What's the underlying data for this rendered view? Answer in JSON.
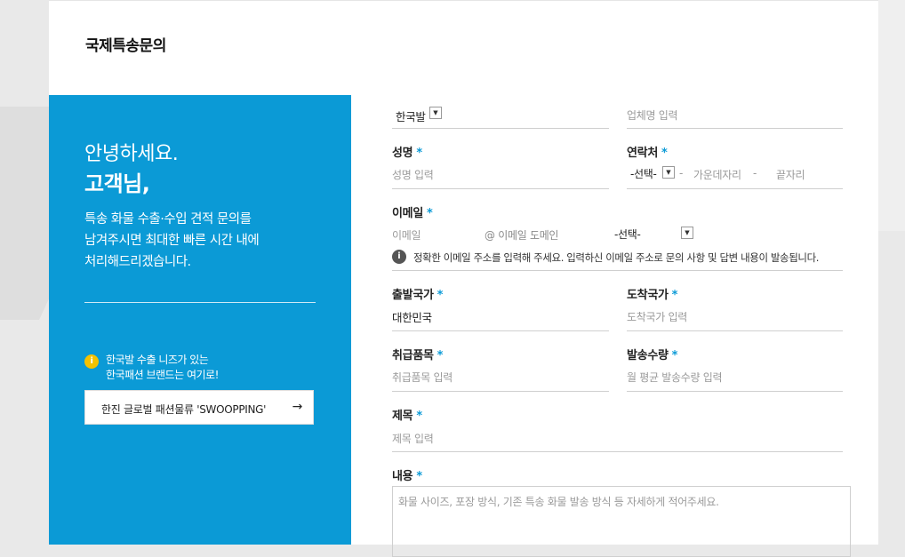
{
  "page": {
    "title": "국제특송문의"
  },
  "intro": {
    "greeting_line1": "안녕하세요.",
    "greeting_line2": "고객님,",
    "text_lines": [
      "특송 화물 수출·수입 견적 문의를",
      "남겨주시면 최대한 빠른 시간 내에",
      "처리해드리겠습니다."
    ],
    "notice_lines": [
      "한국발 수출 니즈가 있는",
      "한국패션 브랜드는 여기로!"
    ],
    "swoopping_button": "한진 글로벌 패션물류 'SWOOPPING'",
    "arrow": "→"
  },
  "form": {
    "origin_select": "한국발",
    "company_placeholder": "업체명 입력",
    "name": {
      "label": "성명",
      "placeholder": "성명 입력"
    },
    "contact": {
      "label": "연락처",
      "prefix_select": "-선택-",
      "separator1": "-",
      "middle_placeholder": "가운데자리",
      "separator2": "-",
      "last_placeholder": "끝자리"
    },
    "email": {
      "label": "이메일",
      "id_placeholder": "이메일",
      "domain_placeholder": "@ 이메일 도메인",
      "domain_select": "-선택-",
      "info_text": "정확한 이메일 주소를 입력해 주세요. 입력하신 이메일 주소로 문의 사항 및 답변 내용이 발송됩니다."
    },
    "departure": {
      "label": "출발국가",
      "value": "대한민국"
    },
    "arrival": {
      "label": "도착국가",
      "placeholder": "도착국가 입력"
    },
    "item": {
      "label": "취급품목",
      "placeholder": "취급품목 입력"
    },
    "volume": {
      "label": "발송수량",
      "placeholder": "월 평균 발송수량 입력"
    },
    "subject": {
      "label": "제목",
      "placeholder": "제목 입력"
    },
    "content": {
      "label": "내용",
      "placeholder": "화물 사이즈, 포장 방식, 기존 특송 화물 발송 방식 등 자세하게 적어주세요."
    },
    "required_mark": "*"
  },
  "colors": {
    "accent": "#0b9ad6",
    "notice": "#f5c200"
  }
}
